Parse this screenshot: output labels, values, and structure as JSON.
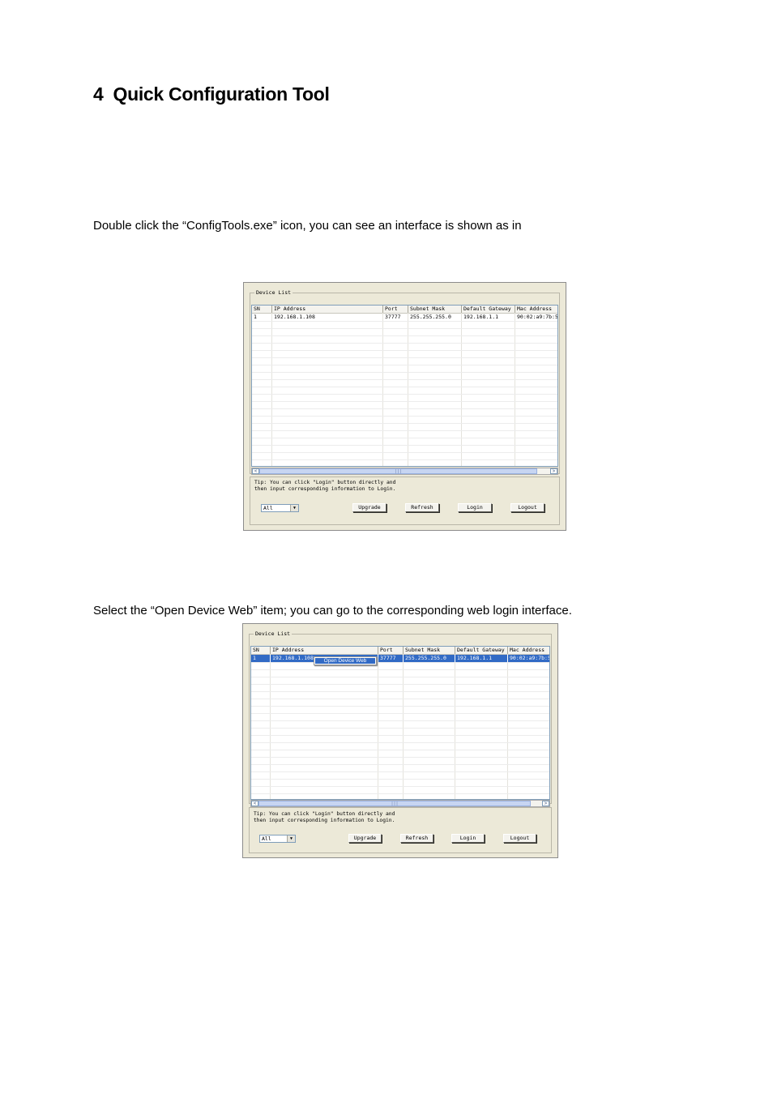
{
  "heading": {
    "number": "4",
    "title": "Quick Configuration Tool"
  },
  "paragraph1": "Double click the “ConfigTools.exe” icon, you can see an interface is shown as in",
  "paragraph2": "Select the “Open Device Web” item; you can go to the corresponding web login interface.",
  "device_list": {
    "legend": "Device List",
    "columns": [
      "SN",
      "IP Address",
      "Port",
      "Subnet Mask",
      "Default Gateway",
      "Mac Address"
    ],
    "rows": [
      {
        "sn": "1",
        "ip": "192.168.1.108",
        "port": "37777",
        "mask": "255.255.255.0",
        "gateway": "192.168.1.1",
        "mac": "90:02:a9:7b:50"
      }
    ],
    "tip_line1": "Tip: You can click \"Login\" button directly and",
    "tip_line2": "then input corresponding information to Login.",
    "filter_value": "All",
    "buttons": {
      "upgrade": "Upgrade",
      "refresh": "Refresh",
      "login": "Login",
      "logout": "Logout"
    },
    "scroll_left": "<",
    "scroll_right": ">",
    "scroll_thumb": "|||"
  },
  "context_menu": {
    "open_device_web": "Open Device Web"
  }
}
